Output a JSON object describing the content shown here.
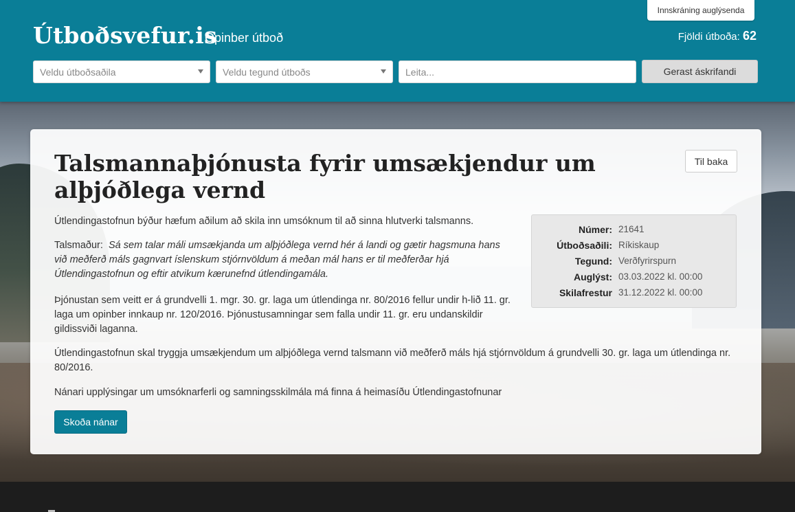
{
  "header": {
    "logo": "Útboðsvefur.is",
    "tagline": "- Opinber útboð",
    "login_label": "Innskráning auglýsenda",
    "count_label": "Fjöldi útboða:",
    "count_value": "62",
    "publisher_select": {
      "value": "Veldu útboðsaðila"
    },
    "type_select": {
      "value": "Veldu tegund útboðs"
    },
    "search": {
      "placeholder": "Leita..."
    },
    "subscribe_label": "Gerast áskrifandi"
  },
  "tender": {
    "title": "Talsmannaþjónusta fyrir umsækjendur um alþjóðlega vernd",
    "back_label": "Til baka",
    "intro": "Útlendingastofnun býður hæfum aðilum að skila inn umsóknum til að sinna hlutverki talsmanns.",
    "definition_label": "Talsmaður:",
    "definition_text": "Sá sem talar máli umsækjanda um alþjóðlega vernd hér á landi og gætir hagsmuna hans við meðferð máls gagnvart íslenskum stjórnvöldum á meðan mál hans er til meðferðar hjá Útlendingastofnun og eftir atvikum kærunefnd útlendingamála.",
    "paragraph_legal": "Þjónustan sem veitt er á grundvelli 1. mgr. 30. gr. laga um útlendinga nr. 80/2016 fellur undir h-lið 11. gr. laga um opinber innkaup nr. 120/2016. Þjónustusamningar sem falla undir 11. gr. eru undanskildir gildissviði laganna.",
    "paragraph_obligation": "Útlendingastofnun skal tryggja umsækjendum um alþjóðlega vernd talsmann við meðferð máls hjá stjórnvöldum á grundvelli 30. gr. laga um útlendinga nr. 80/2016.",
    "paragraph_more": "Nánari upplýsingar um umsóknarferli og samningsskilmála má finna á heimasíðu Útlendingastofnunar",
    "more_label": "Skoða nánar",
    "details": [
      {
        "label": "Númer:",
        "value": "21641"
      },
      {
        "label": "Útboðsaðili:",
        "value": "Ríkiskaup"
      },
      {
        "label": "Tegund:",
        "value": "Verðfyrirspurn"
      },
      {
        "label": "Auglýst:",
        "value": "03.03.2022 kl. 00:00"
      },
      {
        "label": "Skilafrestur",
        "value": "31.12.2022 kl. 00:00"
      }
    ]
  },
  "colors": {
    "brand": "#0a7e97",
    "subscribe_bg": "#dcdcdc",
    "info_bg": "#e8e8e8"
  }
}
